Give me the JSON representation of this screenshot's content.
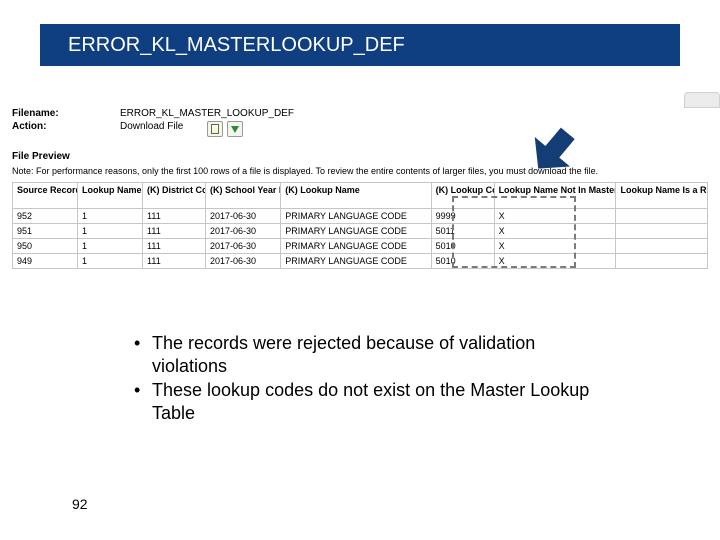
{
  "colors": {
    "brand": "#0f3f80",
    "dash": "#7b7b7b"
  },
  "header": {
    "title": "ERROR_KL_MASTERLOOKUP_DEF"
  },
  "panel": {
    "filename_label": "Filename:",
    "filename_value": "ERROR_KL_MASTER_LOOKUP_DEF",
    "action_label": "Action:",
    "action_value": "Download File",
    "icons": {
      "open": "open-file-icon",
      "download": "download-icon"
    },
    "preview_label": "File Preview",
    "note": "Note: For performance reasons, only the first 100 rows of a file is displayed. To review the entire contents of larger files, you must download the file."
  },
  "table": {
    "columns": [
      "Source Record Number",
      "Lookup Name Error Count",
      "(K) District Code",
      "(K) School Year Date",
      "(K) Lookup Name",
      "(K) Lookup Code",
      "Lookup Name Not In Master Lookup Def Table",
      "Lookup Name Is a Reserved"
    ],
    "rows": [
      [
        "952",
        "1",
        "111",
        "2017-06-30",
        "PRIMARY LANGUAGE CODE",
        "9999",
        "X",
        ""
      ],
      [
        "951",
        "1",
        "111",
        "2017-06-30",
        "PRIMARY LANGUAGE CODE",
        "5011",
        "X",
        ""
      ],
      [
        "950",
        "1",
        "111",
        "2017-06-30",
        "PRIMARY LANGUAGE CODE",
        "5010",
        "X",
        ""
      ],
      [
        "949",
        "1",
        "111",
        "2017-06-30",
        "PRIMARY LANGUAGE CODE",
        "5010",
        "X",
        ""
      ]
    ]
  },
  "bullets": [
    "The records were rejected because of validation violations",
    "These lookup codes do not exist on the Master Lookup Table"
  ],
  "page_number": "92"
}
